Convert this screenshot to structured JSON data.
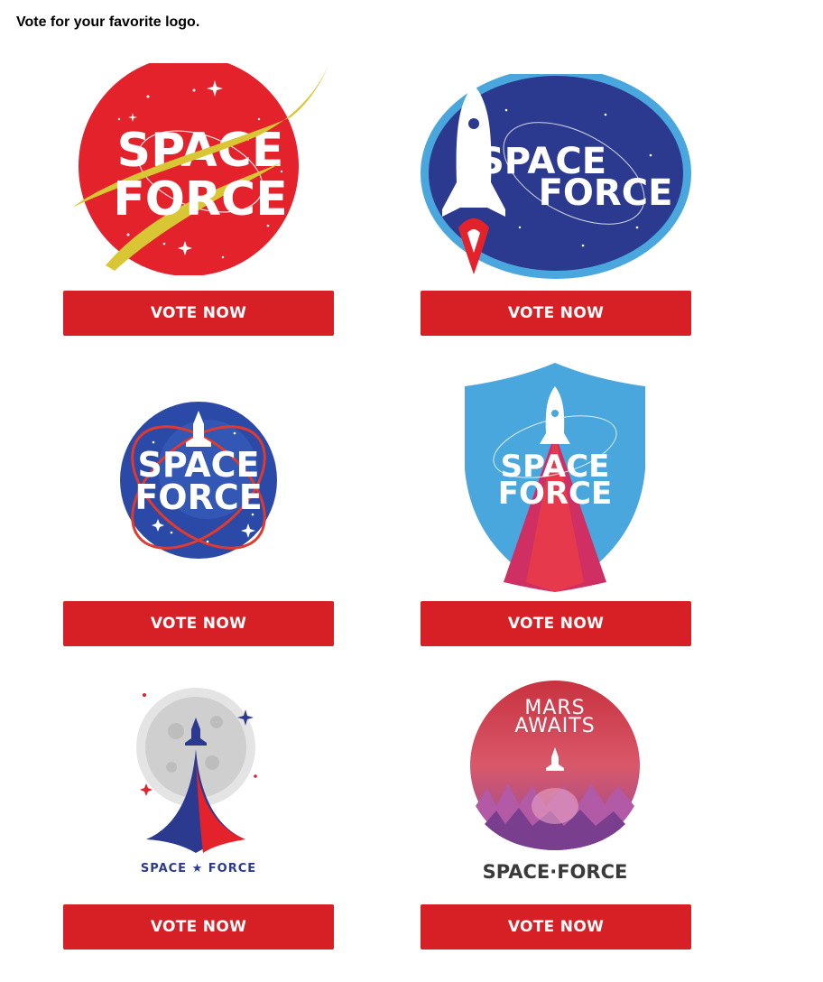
{
  "page": {
    "heading": "Vote for your favorite logo."
  },
  "logos": [
    {
      "text_line1": "SPACE",
      "text_line2": "FORCE",
      "vote_label": "VOTE NOW"
    },
    {
      "text_line1": "SPACE",
      "text_line2": "FORCE",
      "vote_label": "VOTE NOW"
    },
    {
      "text_line1": "SPACE",
      "text_line2": "FORCE",
      "vote_label": "VOTE NOW"
    },
    {
      "text_line1": "SPACE",
      "text_line2": "FORCE",
      "vote_label": "VOTE NOW"
    },
    {
      "text_caption": "SPACE ★ FORCE",
      "vote_label": "VOTE NOW"
    },
    {
      "text_line1": "MARS",
      "text_line2": "AWAITS",
      "text_caption": "SPACE·FORCE",
      "vote_label": "VOTE NOW"
    }
  ],
  "colors": {
    "button": "#d71f26",
    "nasa_red": "#e3222c",
    "navy": "#2b3a8f",
    "sky": "#4aa7de",
    "gold": "#d9c634"
  }
}
